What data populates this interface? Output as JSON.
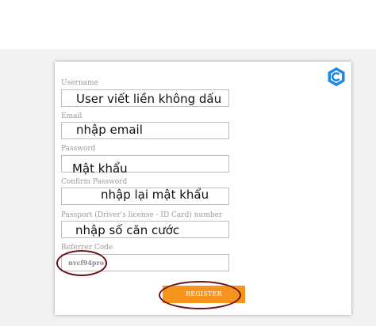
{
  "form": {
    "username_label": "Username",
    "username_value": "User viết liền không dấu",
    "email_label": "Email",
    "email_value": "nhập email",
    "password_label": "Password",
    "password_value": "Mật khẩu",
    "confirm_label": "Confirm Password",
    "confirm_value": "nhập lại mật khẩu",
    "passport_label": "Passport (Driver's license - ID Card) number",
    "passport_value": "nhập số căn cước",
    "referrer_label": "Referrer Code",
    "referrer_value": "nvcf94pro",
    "register_label": "REGISTER"
  },
  "colors": {
    "accent": "#f7941d",
    "logo": "#1e88e5",
    "annotation": "#6b1217"
  },
  "icons": {
    "logo": "hexagon-c-logo-icon"
  }
}
